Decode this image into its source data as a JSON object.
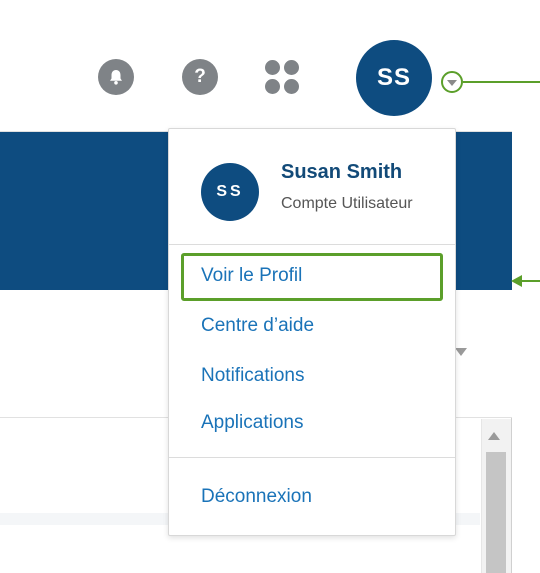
{
  "header": {
    "avatar_initials": "SS",
    "icons": [
      "bell-icon",
      "help-icon",
      "apps-grid-icon",
      "chevron-down-icon"
    ],
    "help_glyph": "?"
  },
  "user_menu": {
    "avatar_initials": "SS",
    "name": "Susan Smith",
    "role": "Compte Utilisateur",
    "items": [
      {
        "label": "Voir le Profil",
        "highlighted": true
      },
      {
        "label": "Centre d’aide"
      },
      {
        "label": "Notifications"
      },
      {
        "label": "Applications"
      }
    ],
    "logout_label": "Déconnexion"
  },
  "colors": {
    "brand_navy": "#0e4c80",
    "link_blue": "#1a73b8",
    "annotation_green": "#5b9f2a",
    "icon_gray": "#7f8387"
  }
}
